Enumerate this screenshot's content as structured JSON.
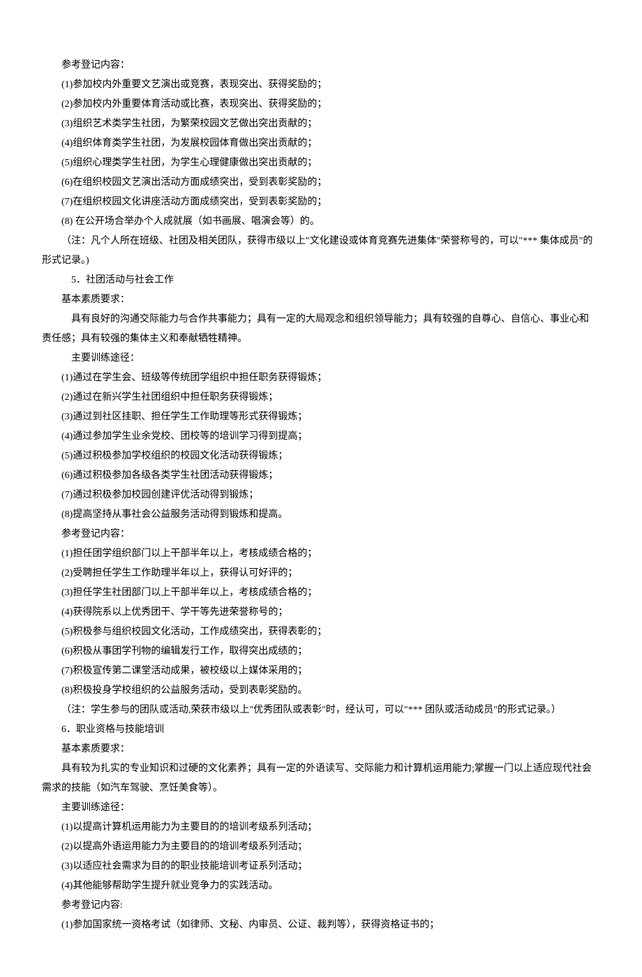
{
  "section4": {
    "ref_title": "参考登记内容：",
    "ref_items": [
      "(1)参加校内外重要文艺演出或竞赛，表现突出、获得奖励的；",
      "(2)参加校内外重要体育活动或比赛，表现突出、获得奖励的；",
      "(3)组织艺术类学生社团，为繁荣校园文艺做出突出贡献的；",
      "(4)组织体育类学生社团，为发展校园体育做出突出贡献的；",
      "(5)组织心理类学生社团，为学生心理健康做出突出贡献的；",
      "(6)在组织校园文艺演出活动方面成绩突出，受到表彰奖励的；",
      "(7)在组织校园文化讲座活动方面成绩突出，受到表彰奖励的；",
      "(8) 在公开场合举办个人成就展（如书画展、唱演会等）的。"
    ],
    "note": "（注：凡个人所在班级、社团及相关团队，获得市级以上\"文化建设或体育竞赛先进集体\"荣誉称号的，可以\"*** 集体成员\"的形式记录。)"
  },
  "section5": {
    "title": "5．社团活动与社会工作",
    "basic_title": "基本素质要求：",
    "basic_text": "具有良好的沟通交际能力与合作共事能力；具有一定的大局观念和组织领导能力；具有较强的自尊心、自信心、事业心和责任感；具有较强的集体主义和奉献牺牲精神。",
    "train_title": "主要训练途径：",
    "train_items": [
      "(1)通过在学生会、班级等传统团学组织中担任职务获得锻炼；",
      "(2)通过在新兴学生社团组织中担任职务获得锻炼；",
      "(3)通过到社区挂职、担任学生工作助理等形式获得锻炼；",
      "(4)通过参加学生业余党校、团校等的培训学习得到提高；",
      "(5)通过积极参加学校组织的校园文化活动获得锻炼；",
      "(6)通过积极参加各级各类学生社团活动获得锻炼；",
      "(7)通过积极参加校园创建评优活动得到锻炼；",
      "(8)提高坚持从事社会公益服务活动得到锻炼和提高。"
    ],
    "ref_title": "参考登记内容：",
    "ref_items": [
      "(1)担任团学组织部门以上干部半年以上，考核成绩合格的；",
      "(2)受聘担任学生工作助理半年以上，获得认可好评的；",
      "(3)担任学生社团部门以上干部半年以上，考核成绩合格的；",
      "(4)获得院系以上优秀团干、学干等先进荣誉称号的；",
      "(5)积极参与组织校园文化活动，工作成绩突出，获得表彰的；",
      "(6)积极从事团学刊物的编辑发行工作，取得突出成绩的；",
      "(7)积极宣传第二课堂活动成果，被校级以上媒体采用的；",
      "(8)积极投身学校组织的公益服务活动，受到表彰奖励的。"
    ],
    "note": "（注：学生参与的团队或活动,荣获市级以上\"优秀团队或表彰\"时，经认可，可以\"*** 团队或活动成员\"的形式记录。）"
  },
  "section6": {
    "title": "6．职业资格与技能培训",
    "basic_title": "基本素质要求：",
    "basic_text": "具有较为扎实的专业知识和过硬的文化素养；具有一定的外语读写、交际能力和计算机运用能力;掌握一门以上适应现代社会需求的技能（如汽车驾驶、烹饪美食等）。",
    "train_title": "主要训练途径：",
    "train_items": [
      "(1)以提高计算机运用能力为主要目的的培训考级系列活动；",
      "(2)以提高外语运用能力为主要目的的培训考级系列活动；",
      "(3)以适应社会需求为目的的职业技能培训考证系列活动；",
      "(4)其他能够帮助学生提升就业竞争力的实践活动。"
    ],
    "ref_title": "参考登记内容:",
    "ref_items": [
      "(1)参加国家统一资格考试（如律师、文秘、内审员、公证、裁判等），获得资格证书的；"
    ]
  }
}
